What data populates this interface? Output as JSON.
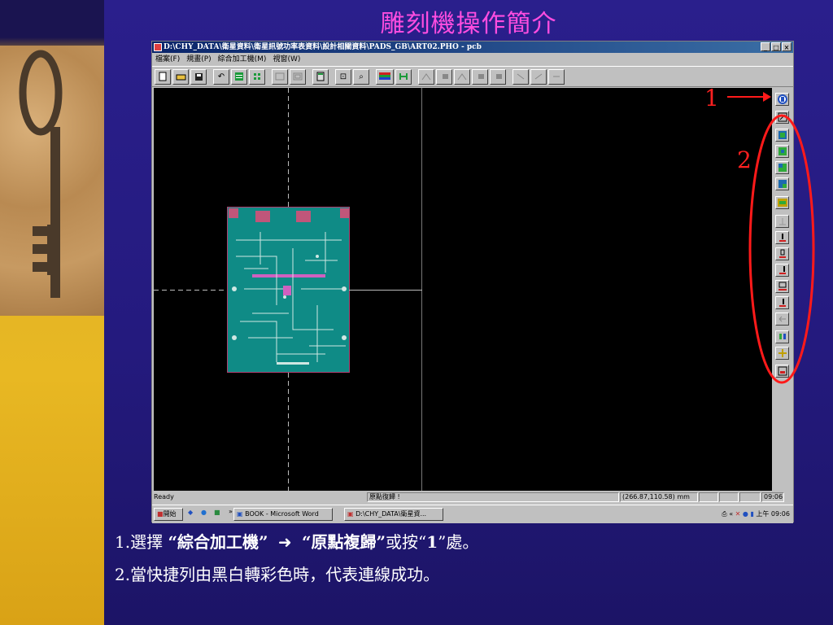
{
  "slide": {
    "title": "雕刻機操作簡介",
    "marker_1": "1",
    "marker_2": "2",
    "caption_line1": {
      "prefix": "1.選擇",
      "term1": "“綜合加工機”",
      "arrow": "➜",
      "term2": "“原點複歸”",
      "middle": "或按“",
      "key": "1",
      "suffix": "”處。"
    },
    "caption_line2": "2.當快捷列由黑白轉彩色時，代表連線成功。"
  },
  "window": {
    "title": "D:\\CHY_DATA\\衛星資料\\衛星訊號功率表資料\\設計相關資料\\PADS_GB\\ART02.PHO - pcb",
    "buttons": [
      "_",
      "□",
      "×"
    ],
    "menu": [
      "檔案(F)",
      "規畫(P)",
      "綜合加工機(M)",
      "視窗(W)"
    ]
  },
  "status": {
    "ready": "Ready",
    "message": "原點復歸 !",
    "coords": "(266.87,110.58) mm",
    "time_cell": "09:06"
  },
  "taskbar": {
    "start": "開始",
    "chevron": "»",
    "tasks": [
      "BOOK - Microsoft Word",
      "D:\\CHY_DATA\\衛星資..."
    ],
    "tray_chevron": "«",
    "clock": "上午 09:06"
  },
  "colors": {
    "title": "#ff4de0",
    "marker": "#ff2020",
    "board": "#0f8b86",
    "highlight_ring": "#ff1a1a"
  }
}
